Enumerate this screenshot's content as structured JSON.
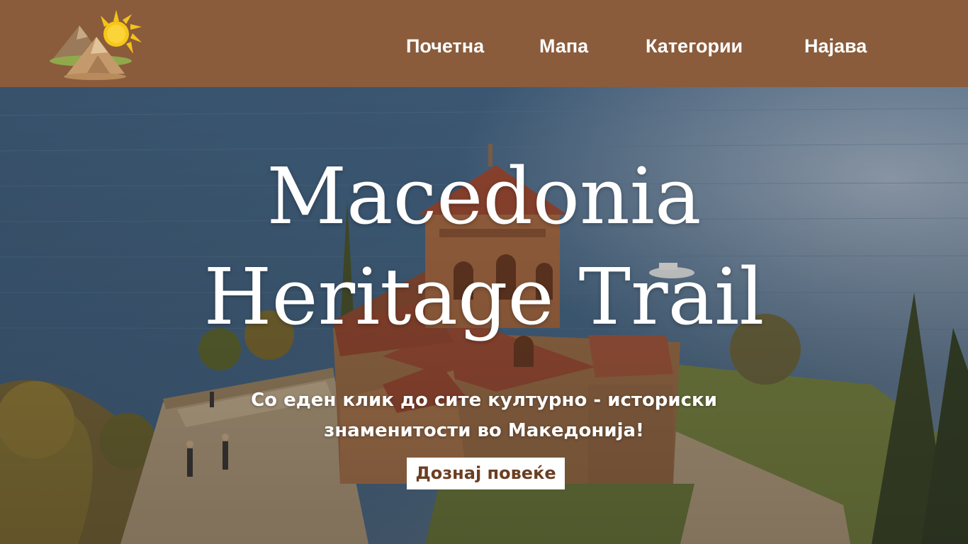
{
  "header": {
    "logo_alt": "Macedonia Heritage Trail logo",
    "nav": {
      "home": "Почетна",
      "map": "Мапа",
      "categories": "Категории",
      "login": "Најава"
    },
    "background_color": "#8a5c3c"
  },
  "hero": {
    "title_line1": "Macedonia",
    "title_line2": "Heritage Trail",
    "subtitle_line1": "Со еден клик до сите културно - историски",
    "subtitle_line2": "знаменитости во Македонија!",
    "cta_label": "Дознај повеќе",
    "cta_text_color": "#6b3e22"
  }
}
